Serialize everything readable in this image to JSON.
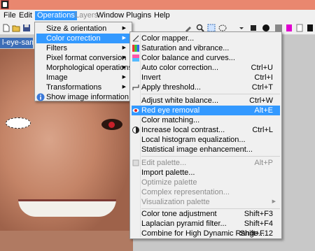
{
  "menubar": {
    "items": [
      {
        "label": "File"
      },
      {
        "label": "Edit"
      },
      {
        "label": "Operations"
      },
      {
        "label": "Layers"
      },
      {
        "label": "Window"
      },
      {
        "label": "Plugins"
      },
      {
        "label": "Help"
      }
    ]
  },
  "document": {
    "tab_label": "l-eye-sam"
  },
  "operations_menu": {
    "items": [
      {
        "label": "Size & orientation"
      },
      {
        "label": "Color correction"
      },
      {
        "label": "Filters"
      },
      {
        "label": "Pixel format conversion"
      },
      {
        "label": "Morphological operations"
      },
      {
        "label": "Image"
      },
      {
        "label": "Transformations"
      },
      {
        "label": "Show image information"
      }
    ]
  },
  "color_correction_menu": {
    "items": [
      {
        "label": "Color mapper...",
        "shortcut": ""
      },
      {
        "label": "Saturation and vibrance...",
        "shortcut": ""
      },
      {
        "label": "Color balance and curves...",
        "shortcut": ""
      },
      {
        "label": "Auto color correction...",
        "shortcut": "Ctrl+U"
      },
      {
        "label": "Invert",
        "shortcut": "Ctrl+I"
      },
      {
        "label": "Apply threshold...",
        "shortcut": "Ctrl+T"
      },
      {
        "label": "Adjust white balance...",
        "shortcut": "Ctrl+W"
      },
      {
        "label": "Red eye removal",
        "shortcut": "Alt+E"
      },
      {
        "label": "Color matching...",
        "shortcut": ""
      },
      {
        "label": "Increase local contrast...",
        "shortcut": "Ctrl+L"
      },
      {
        "label": "Local histogram equalization...",
        "shortcut": ""
      },
      {
        "label": "Statistical image enhancement...",
        "shortcut": ""
      },
      {
        "label": "Edit palette...",
        "shortcut": "Alt+P"
      },
      {
        "label": "Import palette...",
        "shortcut": ""
      },
      {
        "label": "Optimize palette",
        "shortcut": ""
      },
      {
        "label": "Complex representation...",
        "shortcut": ""
      },
      {
        "label": "Visualization palette",
        "shortcut": ""
      },
      {
        "label": "Color tone adjustment",
        "shortcut": "Shift+F3"
      },
      {
        "label": "Laplacian pyramid filter...",
        "shortcut": "Shift+F4"
      },
      {
        "label": "Combine for High Dynamic Range...",
        "shortcut": "Shift+F12"
      }
    ]
  },
  "colors": {
    "highlight": "#3399ff",
    "titlebar": "#e9876f"
  }
}
